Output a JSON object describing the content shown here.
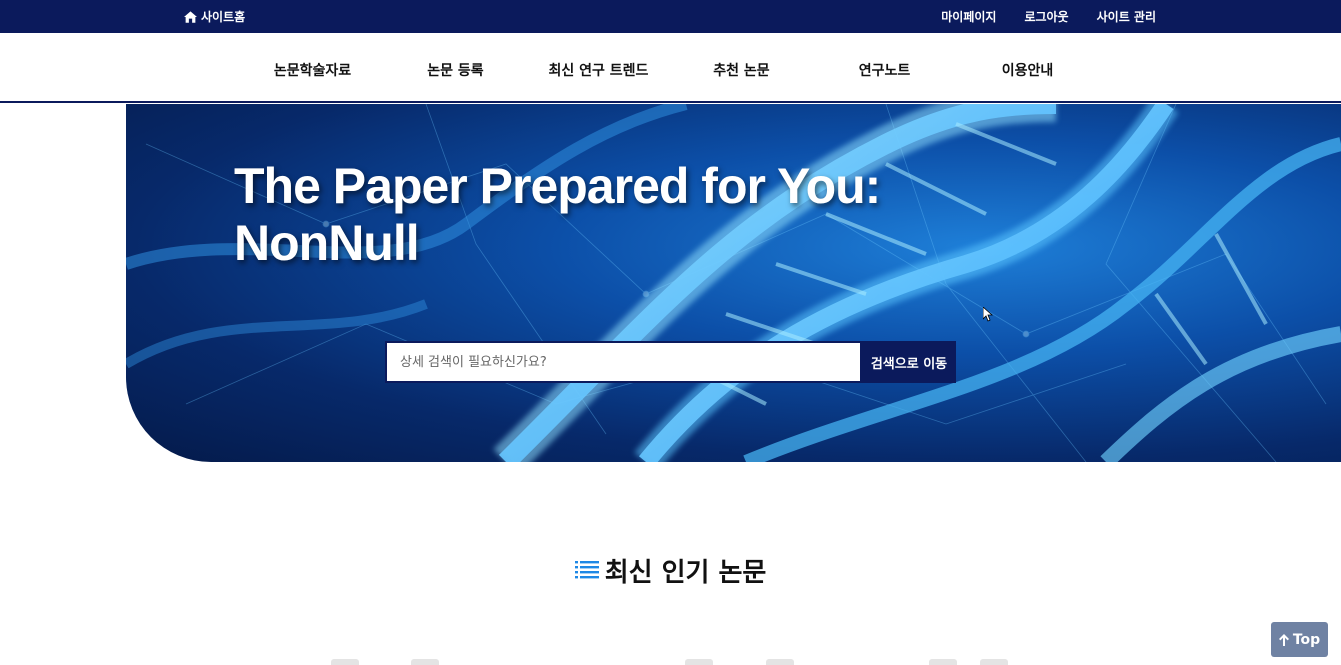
{
  "topbar": {
    "home_label": "사이트홈",
    "links": [
      "마이페이지",
      "로그아웃",
      "사이트 관리"
    ]
  },
  "nav": {
    "items": [
      "논문학술자료",
      "논문 등록",
      "최신 연구 트렌드",
      "추천 논문",
      "연구노트",
      "이용안내"
    ]
  },
  "hero": {
    "title_line1": "The Paper Prepared for You:",
    "title_line2": "NonNull",
    "search_placeholder": "상세 검색이 필요하신가요?",
    "search_button": "검색으로 이동"
  },
  "section": {
    "title": "최신 인기 논문",
    "icon": "list-icon"
  },
  "top_button": {
    "label": "Top",
    "icon": "arrow-up-icon"
  },
  "colors": {
    "navy": "#0b1a5c",
    "top_button": "#6f82a3"
  }
}
